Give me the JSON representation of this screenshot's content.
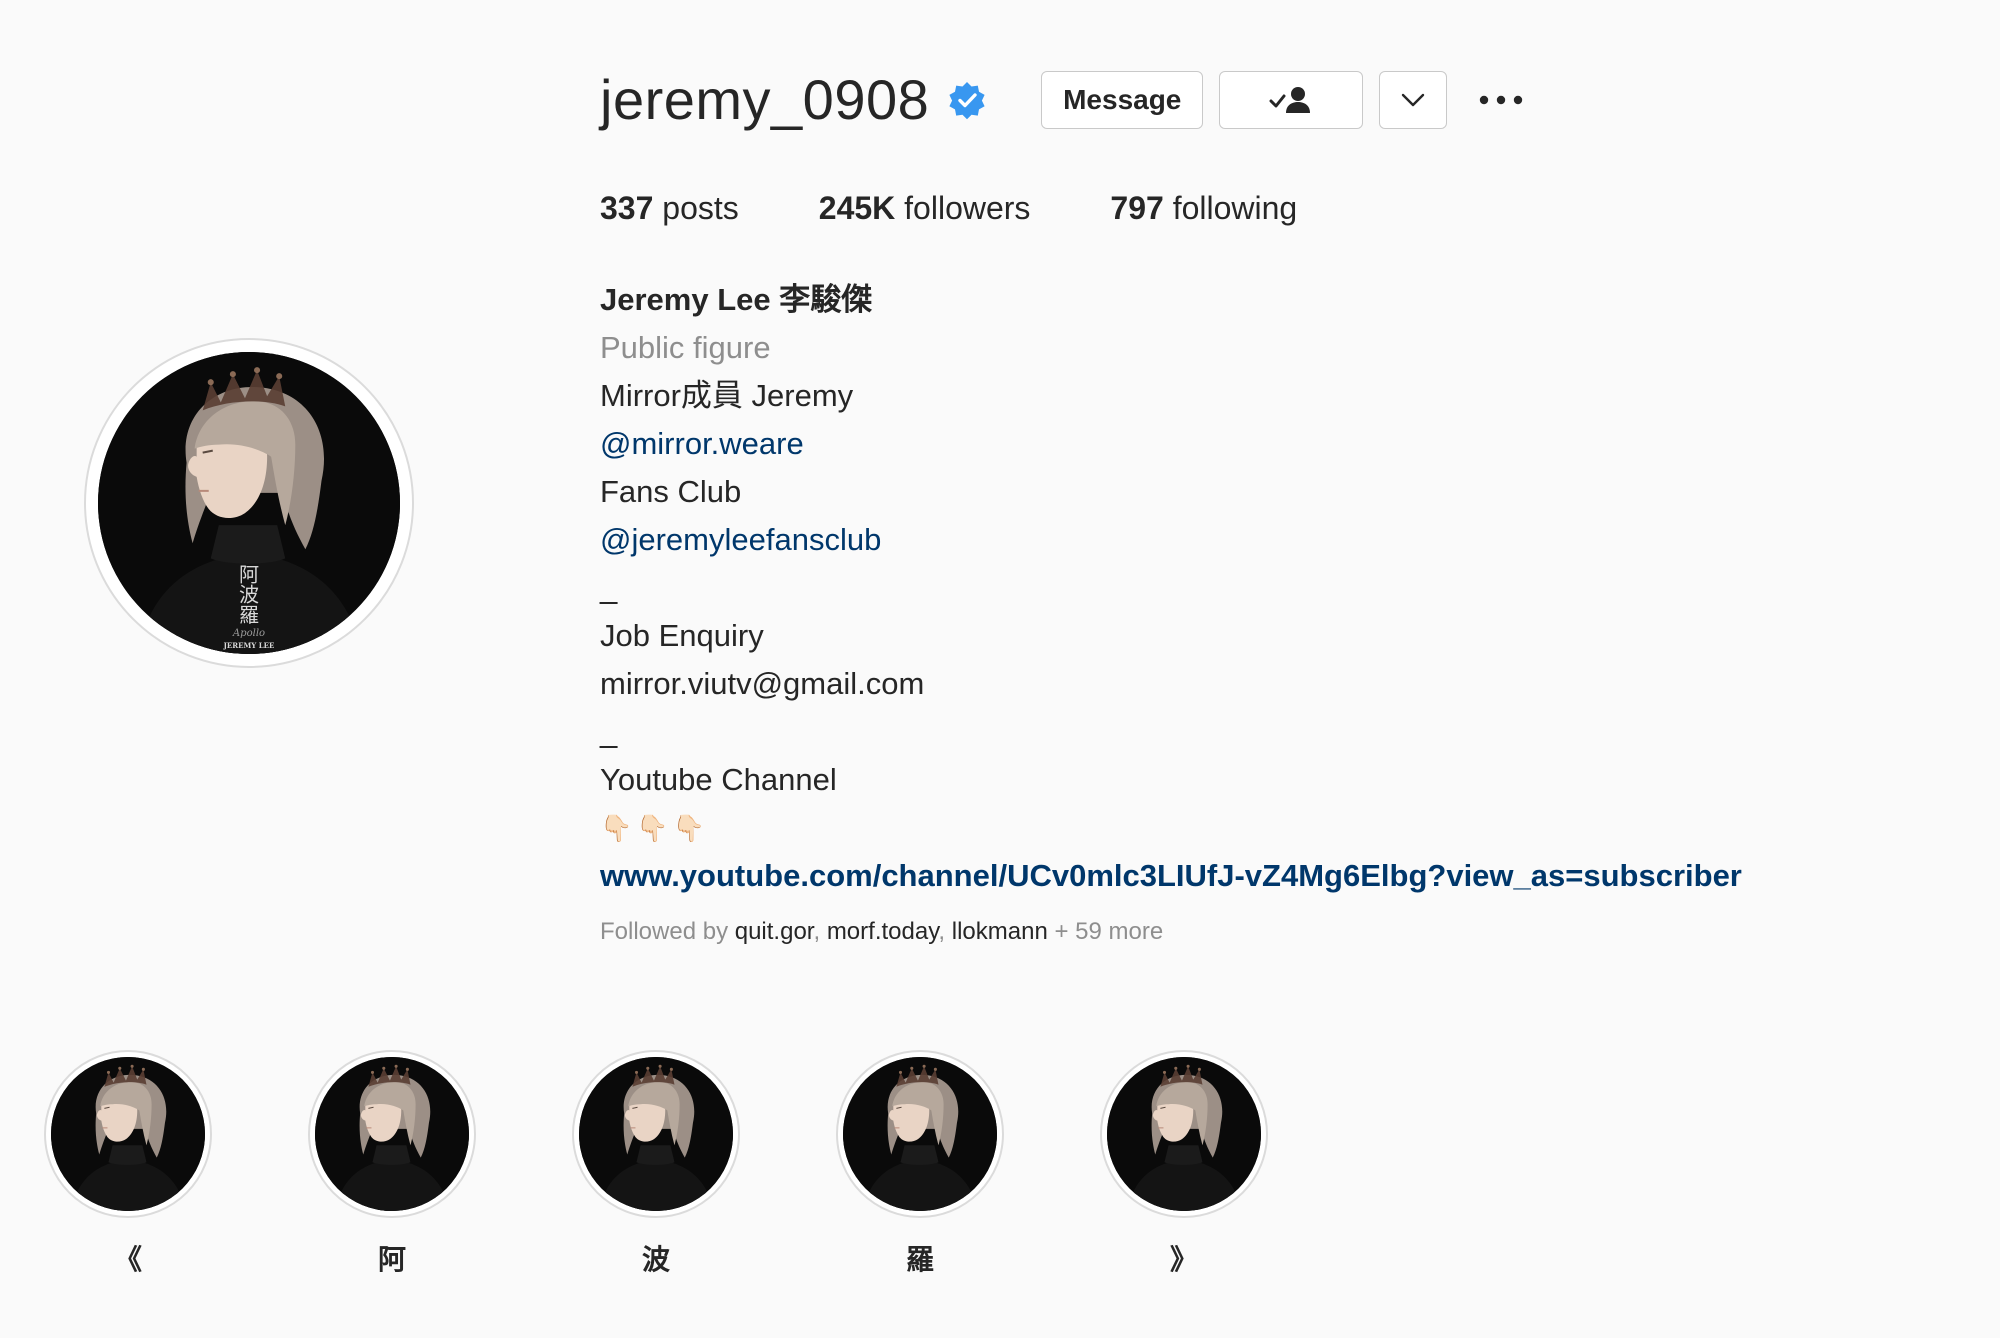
{
  "profile": {
    "username": "jeremy_0908",
    "verified": true,
    "avatar_icon": "profile-photo",
    "avatar_caption_chars": [
      "阿",
      "波",
      "羅"
    ],
    "avatar_caption_script": "Apollo",
    "avatar_caption_name": "JEREMY LEE"
  },
  "actions": {
    "message_label": "Message",
    "follow_icon": "user-check-icon",
    "dropdown_icon": "chevron-down-icon",
    "more_icon": "more-horizontal-icon"
  },
  "stats": {
    "posts_count": "337",
    "posts_label": "posts",
    "followers_count": "245K",
    "followers_label": "followers",
    "following_count": "797",
    "following_label": "following"
  },
  "bio": {
    "full_name": "Jeremy Lee 李駿傑",
    "category": "Public figure",
    "line1": "Mirror成員 Jeremy",
    "mention1": "@mirror.weare",
    "line2": "Fans Club",
    "mention2": "@jeremyleefansclub",
    "divider1": "_",
    "line3": "Job Enquiry",
    "line4": "mirror.viutv@gmail.com",
    "divider2": "_",
    "line5": "Youtube Channel",
    "emoji": "👇🏻👇🏻👇🏻",
    "website": "www.youtube.com/channel/UCv0mlc3LIUfJ-vZ4Mg6Elbg?view_as=subscriber"
  },
  "followed_by": {
    "prefix": "Followed by",
    "user1": "quit.gor",
    "user2": "morf.today",
    "user3": "llokmann",
    "more": "+ 59 more"
  },
  "highlights": [
    {
      "label": "《"
    },
    {
      "label": "阿"
    },
    {
      "label": "波"
    },
    {
      "label": "羅"
    },
    {
      "label": "》"
    }
  ],
  "colors": {
    "background": "#fafafa",
    "text": "#262626",
    "secondary": "#8e8e8e",
    "link": "#00376b",
    "verified": "#3897f0",
    "border": "#dbdbdb"
  }
}
